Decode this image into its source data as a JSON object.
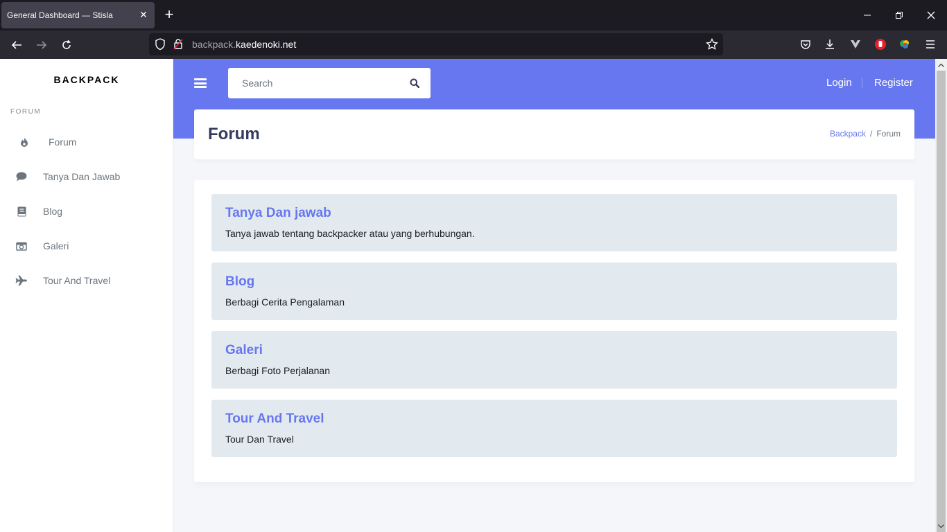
{
  "browser": {
    "tab_title": "General Dashboard — Stisla",
    "url_prefix": "backpack.",
    "url_domain": "kaedenoki.net"
  },
  "sidebar": {
    "brand": "BACKPACK",
    "menu_header": "FORUM",
    "items": [
      {
        "label": "Forum",
        "icon": "fire-icon"
      },
      {
        "label": "Tanya Dan Jawab",
        "icon": "comment-icon"
      },
      {
        "label": "Blog",
        "icon": "book-icon"
      },
      {
        "label": "Galeri",
        "icon": "camera-icon"
      },
      {
        "label": "Tour And Travel",
        "icon": "plane-icon"
      }
    ]
  },
  "topnav": {
    "search_placeholder": "Search",
    "login": "Login",
    "register": "Register"
  },
  "section": {
    "title": "Forum",
    "breadcrumb": [
      "Backpack",
      "/",
      "Forum"
    ]
  },
  "forums": [
    {
      "title": "Tanya Dan jawab",
      "desc": "Tanya jawab tentang backpacker atau yang berhubungan."
    },
    {
      "title": "Blog",
      "desc": "Berbagi Cerita Pengalaman"
    },
    {
      "title": "Galeri",
      "desc": "Berbagi Foto Perjalanan"
    },
    {
      "title": "Tour And Travel",
      "desc": "Tour Dan Travel"
    }
  ],
  "colors": {
    "primary": "#6777ef",
    "forum_item_bg": "#e3eaef",
    "browser_dark": "#1c1b22"
  }
}
